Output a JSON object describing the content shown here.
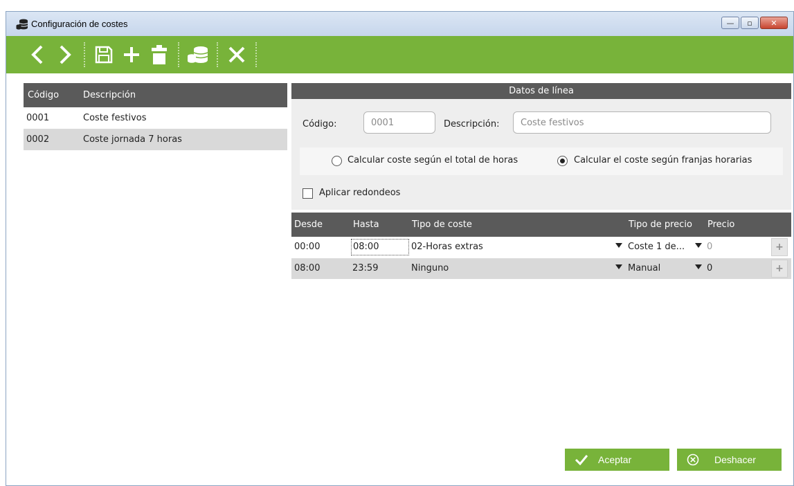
{
  "window": {
    "title": "Configuración de costes",
    "controls": {
      "minimize": "—",
      "maximize": "▫",
      "close": "✕"
    }
  },
  "toolbar": {
    "items": [
      "arrow-left-icon",
      "arrow-right-icon",
      "save-icon",
      "plus-icon",
      "trash-icon",
      "coins-icon",
      "close-icon"
    ]
  },
  "list": {
    "headers": {
      "code": "Código",
      "description": "Descripción"
    },
    "rows": [
      {
        "code": "0001",
        "description": "Coste festivos",
        "selected": false
      },
      {
        "code": "0002",
        "description": "Coste jornada 7 horas",
        "selected": true
      }
    ]
  },
  "details": {
    "section_title": "Datos de línea",
    "code_label": "Código:",
    "code_value": "0001",
    "description_label": "Descripción:",
    "description_value": "Coste festivos",
    "radio_total": "Calcular coste según el total de horas",
    "radio_bands": "Calcular el coste según franjas horarias",
    "selected_mode": "bands",
    "rounding_label": "Aplicar redondeos",
    "rounding_checked": false
  },
  "grid": {
    "headers": {
      "from": "Desde",
      "to": "Hasta",
      "cost_type": "Tipo de coste",
      "price_type": "Tipo de precio",
      "price": "Precio"
    },
    "rows": [
      {
        "from": "00:00",
        "to": "08:00",
        "cost_type": "02-Horas extras",
        "price_type": "Coste 1 de...",
        "price": "0"
      },
      {
        "from": "08:00",
        "to": "23:59",
        "cost_type": "Ninguno",
        "price_type": "Manual",
        "price": "0"
      }
    ],
    "row_action": "+"
  },
  "actions": {
    "accept": "Aceptar",
    "undo": "Deshacer"
  },
  "colors": {
    "accent": "#78b33a",
    "header": "#5a5a5a",
    "selected_row": "#d9d9d9"
  }
}
